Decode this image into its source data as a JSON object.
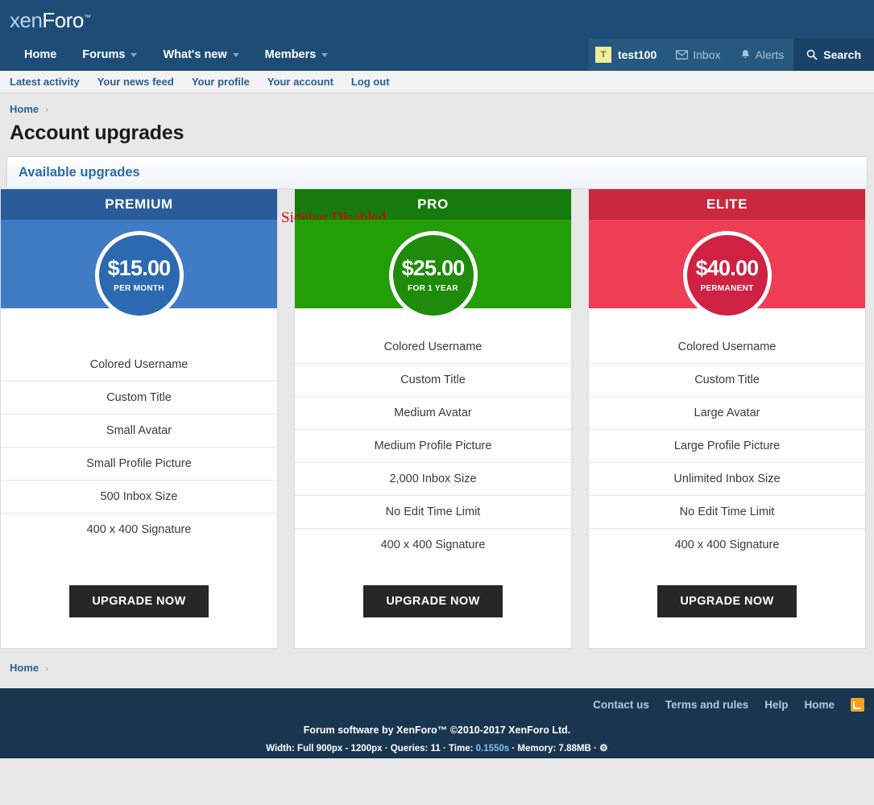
{
  "site": {
    "logo_prefix": "xen",
    "logo_suffix": "Foro",
    "logo_tm": "™"
  },
  "nav": {
    "items": [
      {
        "label": "Home",
        "has_caret": false
      },
      {
        "label": "Forums",
        "has_caret": true
      },
      {
        "label": "What's new",
        "has_caret": true
      },
      {
        "label": "Members",
        "has_caret": true
      }
    ],
    "user": {
      "avatar_letter": "T",
      "username": "test100"
    },
    "inbox_label": "Inbox",
    "alerts_label": "Alerts",
    "search_label": "Search"
  },
  "subnav": {
    "items": [
      {
        "label": "Latest activity"
      },
      {
        "label": "Your news feed"
      },
      {
        "label": "Your profile"
      },
      {
        "label": "Your account"
      },
      {
        "label": "Log out"
      }
    ]
  },
  "breadcrumb": {
    "home_label": "Home",
    "separator": "›"
  },
  "main": {
    "page_title": "Account upgrades",
    "sidebar_note": "Sidebar Disabled",
    "panel_title": "Available upgrades"
  },
  "cards": [
    {
      "name": "PREMIUM",
      "price": "$15.00",
      "period": "PER MONTH",
      "header_color": "#2a5c9a",
      "band_color": "#3f7cc4",
      "circle_color": "#2b6ab0",
      "features": [
        "Colored Username",
        "Custom Title",
        "Small Avatar",
        "Small Profile Picture",
        "500 Inbox Size",
        "400 x 400 Signature"
      ],
      "button_label": "UPGRADE NOW"
    },
    {
      "name": "PRO",
      "price": "$25.00",
      "period": "FOR 1 YEAR",
      "header_color": "#177a0c",
      "band_color": "#249e07",
      "circle_color": "#1f8b0b",
      "features": [
        "Colored Username",
        "Custom Title",
        "Medium Avatar",
        "Medium Profile Picture",
        "2,000 Inbox Size",
        "No Edit Time Limit",
        "400 x 400 Signature"
      ],
      "button_label": "UPGRADE NOW"
    },
    {
      "name": "ELITE",
      "price": "$40.00",
      "period": "PERMANENT",
      "header_color": "#c9283e",
      "band_color": "#ee3e56",
      "circle_color": "#cf2243",
      "features": [
        "Colored Username",
        "Custom Title",
        "Large Avatar",
        "Large Profile Picture",
        "Unlimited Inbox Size",
        "No Edit Time Limit",
        "400 x 400 Signature"
      ],
      "button_label": "UPGRADE NOW"
    }
  ],
  "footer": {
    "links": [
      {
        "label": "Contact us"
      },
      {
        "label": "Terms and rules"
      },
      {
        "label": "Help"
      },
      {
        "label": "Home"
      }
    ],
    "rss_name": "rss-icon",
    "copyright": "Forum software by XenForo™ ©2010-2017 XenForo Ltd.",
    "debug_prefix": "Width: Full 900px - 1200px · Queries: 11 · Time: ",
    "debug_time": "0.1550s",
    "debug_suffix": " · Memory: 7.88MB · ",
    "debug_gear": "⚙"
  },
  "colors": {
    "header_bg": "#1d4d77",
    "footer_bg": "#18364f",
    "link_blue": "#2b5f8c",
    "accent_red": "#e00000",
    "rss_orange": "#f9a11b",
    "button_dark": "#272727"
  }
}
